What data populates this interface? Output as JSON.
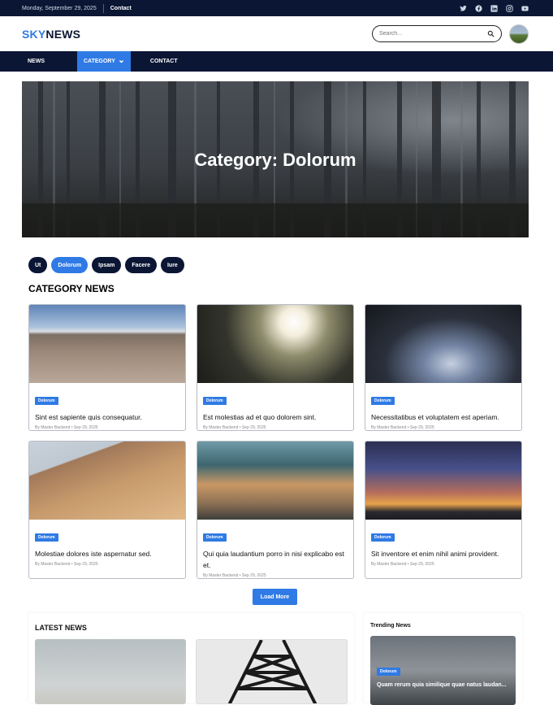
{
  "topbar": {
    "date": "Monday, September 29, 2025",
    "contact": "Contact"
  },
  "socials": [
    "twitter-icon",
    "facebook-icon",
    "linkedin-icon",
    "instagram-icon",
    "youtube-icon"
  ],
  "header": {
    "logo_sky": "SKY",
    "logo_news": "NEWS",
    "search_placeholder": "Search..."
  },
  "nav": {
    "news": "NEWS",
    "category": "CATEGORY",
    "contact": "CONTACT"
  },
  "hero": {
    "title": "Category: Dolorum"
  },
  "pills": [
    "Ut",
    "Dolorum",
    "Ipsam",
    "Facere",
    "Iure"
  ],
  "active_pill": "Dolorum",
  "section_title": "CATEGORY NEWS",
  "cards": [
    {
      "badge": "Dolorum",
      "title": "Sint est sapiente quis consequatur.",
      "meta": "By Master Backend • Sep 29, 2025"
    },
    {
      "badge": "Dolorum",
      "title": "Est molestias ad et quo dolorem sint.",
      "meta": "By Master Backend • Sep 29, 2025"
    },
    {
      "badge": "Dolorum",
      "title": "Necessitatibus et voluptatem est aperiam.",
      "meta": "By Master Backend • Sep 29, 2025"
    },
    {
      "badge": "Dolorum",
      "title": "Molestiae dolores iste aspernatur sed.",
      "meta": "By Master Backend • Sep 29, 2025"
    },
    {
      "badge": "Dolorum",
      "title": "Qui quia laudantium porro in nisi explicabo est et.",
      "meta": "By Master Backend • Sep 29, 2025"
    },
    {
      "badge": "Dolorum",
      "title": "Sit inventore et enim nihil animi provident.",
      "meta": "By Master Backend • Sep 29, 2025"
    }
  ],
  "load_more": "Load More",
  "latest": {
    "title": "LATEST NEWS"
  },
  "trending": {
    "title": "Trending News",
    "badge": "Dolorum",
    "headline": "Quam rerum quia similique quae natus laudan..."
  },
  "colors": {
    "navy": "#0b1634",
    "accent": "#2f7ae5"
  }
}
